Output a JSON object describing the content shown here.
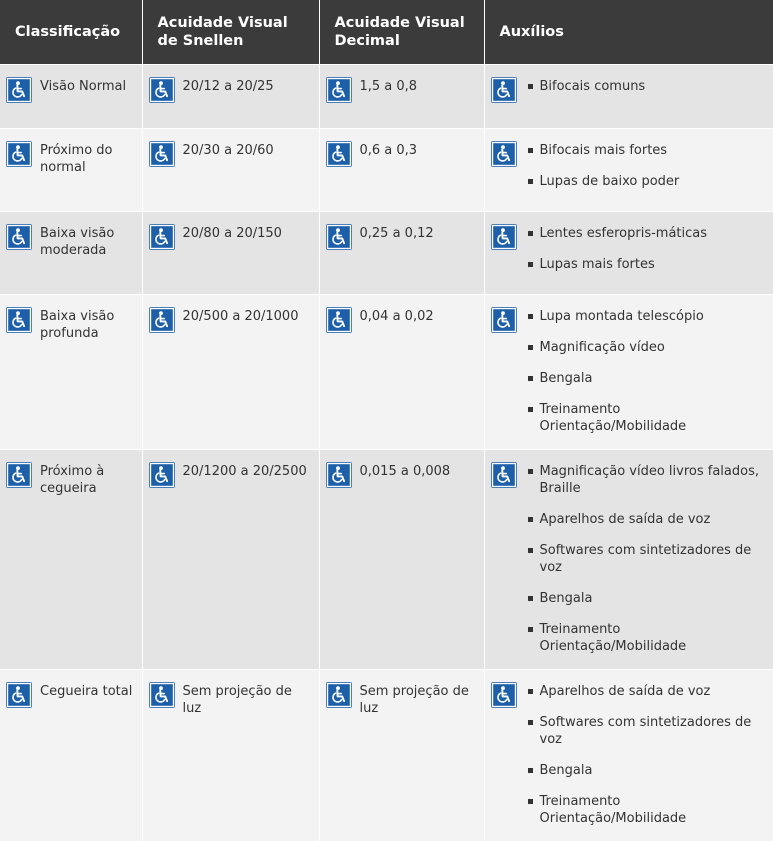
{
  "headers": [
    "Classificação",
    "Acuidade Visual de Snellen",
    "Acuidade Visual Decimal",
    "Auxílios"
  ],
  "icon": "wheelchair-accessibility-icon",
  "colors": {
    "header_bg": "#3b3b3b",
    "row_odd": "#e4e4e4",
    "row_even": "#f3f3f3",
    "icon_bg": "#1d5fa8"
  },
  "rows": [
    {
      "classificacao": "Visão Normal",
      "snellen": "20/12 a 20/25",
      "decimal": "1,5 a 0,8",
      "auxilios": [
        "Bifocais comuns"
      ]
    },
    {
      "classificacao": "Próximo do normal",
      "snellen": "20/30 a 20/60",
      "decimal": "0,6 a 0,3",
      "auxilios": [
        "Bifocais mais fortes",
        "Lupas de baixo poder"
      ]
    },
    {
      "classificacao": "Baixa visão moderada",
      "snellen": "20/80 a 20/150",
      "decimal": "0,25 a 0,12",
      "auxilios": [
        "Lentes esferopris-máticas",
        "Lupas mais fortes"
      ]
    },
    {
      "classificacao": "Baixa visão profunda",
      "snellen": "20/500 a 20/1000",
      "decimal": "0,04 a 0,02",
      "auxilios": [
        "Lupa montada telescópio",
        "Magnificação vídeo",
        "Bengala",
        "Treinamento Orientação/Mobilidade"
      ]
    },
    {
      "classificacao": "Próximo à cegueira",
      "snellen": "20/1200 a 20/2500",
      "decimal": "0,015 a 0,008",
      "auxilios": [
        "Magnificação vídeo livros falados, Braille",
        "Aparelhos de saída de voz",
        "Softwares com sintetizadores de voz",
        "Bengala",
        "Treinamento Orientação/Mobilidade"
      ]
    },
    {
      "classificacao": "Cegueira total",
      "snellen": "Sem projeção de luz",
      "decimal": "Sem projeção de luz",
      "auxilios": [
        "Aparelhos de saída de voz",
        "Softwares com sintetizadores de voz",
        "Bengala",
        "Treinamento Orientação/Mobilidade"
      ]
    }
  ]
}
